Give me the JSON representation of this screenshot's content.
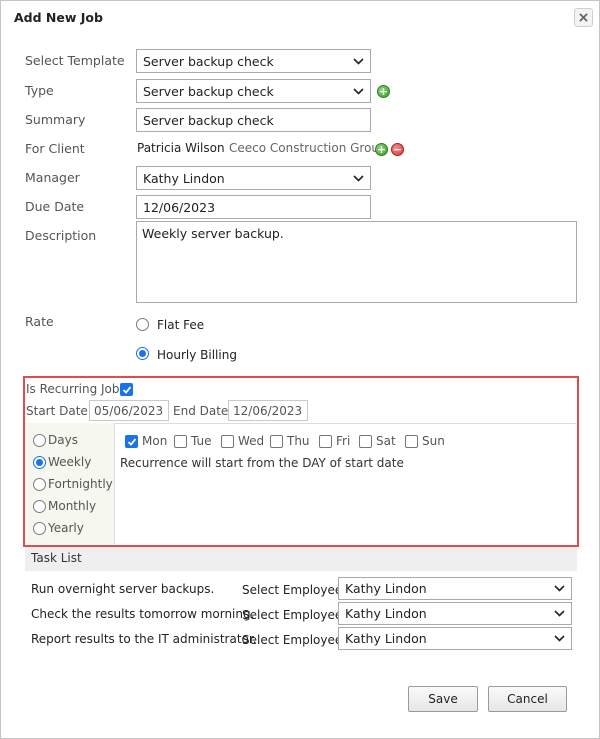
{
  "dialog": {
    "title": "Add New Job"
  },
  "form": {
    "template": {
      "label": "Select Template",
      "value": "Server backup check"
    },
    "type": {
      "label": "Type",
      "value": "Server backup check"
    },
    "summary": {
      "label": "Summary",
      "value": "Server backup check"
    },
    "client": {
      "label": "For Client",
      "name": "Patricia Wilson",
      "company": "Ceeco Construction Group"
    },
    "manager": {
      "label": "Manager",
      "value": "Kathy Lindon"
    },
    "due_date": {
      "label": "Due Date",
      "value": "12/06/2023"
    },
    "description": {
      "label": "Description",
      "value": "Weekly server backup."
    },
    "rate": {
      "label": "Rate",
      "options": [
        "Flat Fee",
        "Hourly Billing"
      ],
      "selected": "Hourly Billing"
    }
  },
  "recurring": {
    "label": "Is Recurring Job",
    "checked": true,
    "start_label": "Start Date:",
    "start_value": "05/06/2023",
    "end_label": "End Date:",
    "end_value": "12/06/2023",
    "frequencies": [
      "Days",
      "Weekly",
      "Fortnightly",
      "Monthly",
      "Yearly"
    ],
    "selected_frequency": "Weekly",
    "days": [
      {
        "label": "Mon",
        "checked": true
      },
      {
        "label": "Tue",
        "checked": false
      },
      {
        "label": "Wed",
        "checked": false
      },
      {
        "label": "Thu",
        "checked": false
      },
      {
        "label": "Fri",
        "checked": false
      },
      {
        "label": "Sat",
        "checked": false
      },
      {
        "label": "Sun",
        "checked": false
      }
    ],
    "note": "Recurrence will start from the DAY of start date"
  },
  "tasks": {
    "header": "Task List",
    "employee_label": "Select Employee",
    "items": [
      {
        "name": "Run overnight server backups.",
        "employee": "Kathy Lindon"
      },
      {
        "name": "Check the results tomorrow morning.",
        "employee": "Kathy Lindon"
      },
      {
        "name": "Report results to the IT administrator.",
        "employee": "Kathy Lindon"
      }
    ]
  },
  "actions": {
    "save": "Save",
    "cancel": "Cancel"
  },
  "colors": {
    "accent": "#1a73e8",
    "highlight_border": "#e04b4b",
    "add": "#3a9a2a",
    "remove": "#d23a3a"
  }
}
